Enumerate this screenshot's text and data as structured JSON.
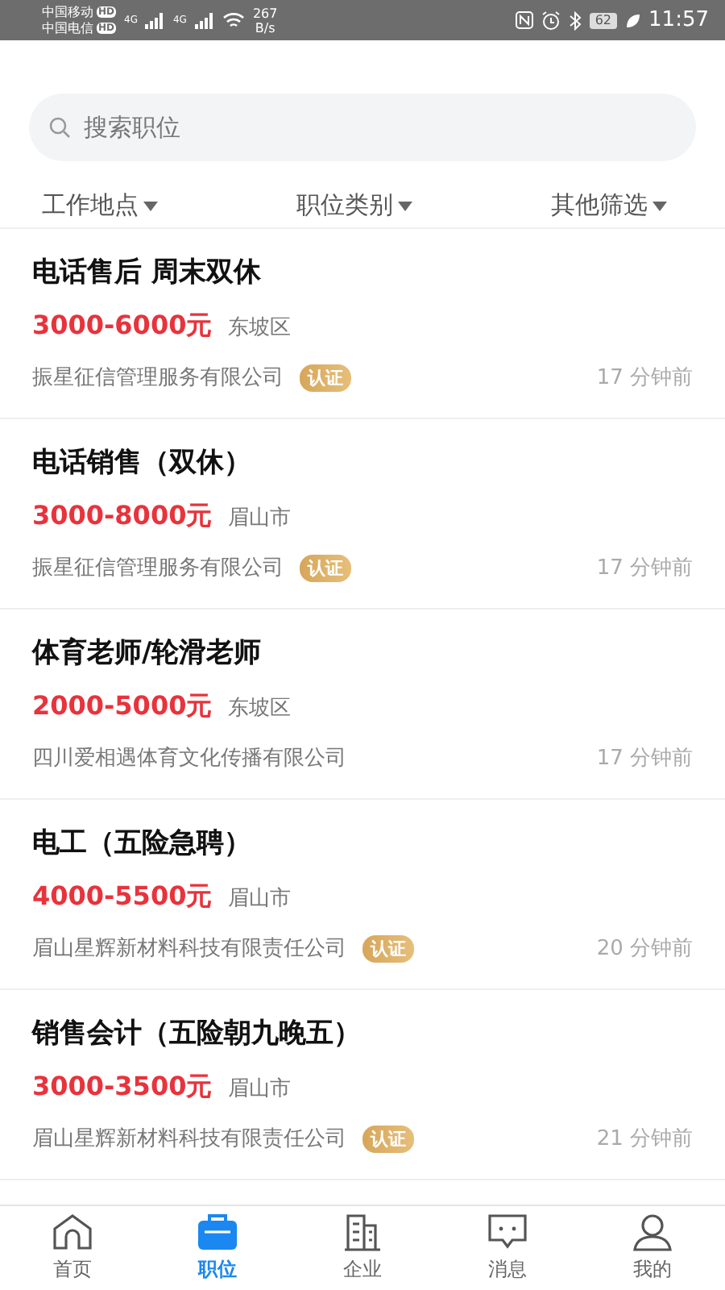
{
  "status_bar": {
    "carriers": [
      "中国移动",
      "中国电信"
    ],
    "carrier_badges": [
      "HD",
      "HD"
    ],
    "signal_labels": [
      "4G",
      "4G"
    ],
    "speed_value": "267",
    "speed_unit": "B/s",
    "battery": "62",
    "time": "11:57"
  },
  "search": {
    "placeholder": "搜索职位"
  },
  "filters": [
    "工作地点",
    "职位类别",
    "其他筛选"
  ],
  "jobs": [
    {
      "title": "电话售后 周末双休",
      "salary": "3000-6000元",
      "location": "东坡区",
      "company": "振星征信管理服务有限公司",
      "verified": true,
      "badge": "认证",
      "time": "17 分钟前"
    },
    {
      "title": "电话销售（双休）",
      "salary": "3000-8000元",
      "location": "眉山市",
      "company": "振星征信管理服务有限公司",
      "verified": true,
      "badge": "认证",
      "time": "17 分钟前"
    },
    {
      "title": "体育老师/轮滑老师",
      "salary": "2000-5000元",
      "location": "东坡区",
      "company": "四川爱相遇体育文化传播有限公司",
      "verified": false,
      "time": "17 分钟前"
    },
    {
      "title": "电工（五险急聘）",
      "salary": "4000-5500元",
      "location": "眉山市",
      "company": "眉山星辉新材料科技有限责任公司",
      "verified": true,
      "badge": "认证",
      "time": "20 分钟前"
    },
    {
      "title": "销售会计（五险朝九晚五）",
      "salary": "3000-3500元",
      "location": "眉山市",
      "company": "眉山星辉新材料科技有限责任公司",
      "verified": true,
      "badge": "认证",
      "time": "21 分钟前"
    }
  ],
  "nav": [
    {
      "kind": "home",
      "label": "首页",
      "selected": false
    },
    {
      "kind": "jobs",
      "label": "职位",
      "selected": true
    },
    {
      "kind": "company",
      "label": "企业",
      "selected": false
    },
    {
      "kind": "messages",
      "label": "消息",
      "selected": false
    },
    {
      "kind": "profile",
      "label": "我的",
      "selected": false
    }
  ]
}
